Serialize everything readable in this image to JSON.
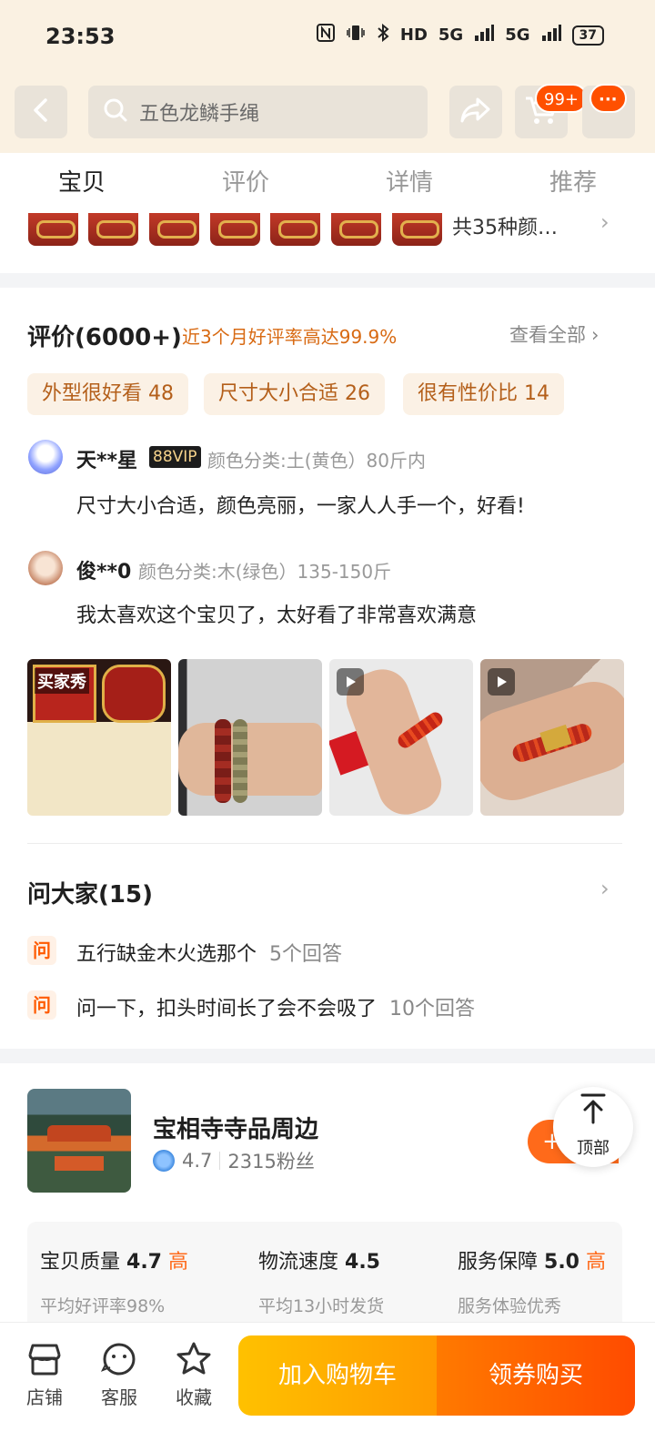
{
  "status_bar": {
    "time": "23:53",
    "network": "HD",
    "signal1": "5G",
    "signal2": "5G",
    "battery": "37"
  },
  "header": {
    "search_text": "五色龙鳞手绳",
    "cart_badge": "99+",
    "more_badge": "···",
    "more_icon": "ellipsis-icon"
  },
  "tabs": [
    {
      "label": "宝贝",
      "active": true
    },
    {
      "label": "评价",
      "active": false
    },
    {
      "label": "详情",
      "active": false
    },
    {
      "label": "推荐",
      "active": false
    }
  ],
  "variants": {
    "thumb_count": 7,
    "more_text": "共35种颜…",
    "chevron": "›"
  },
  "reviews": {
    "title": "评价(6000+)",
    "subtitle": "近3个月好评率高达99.9%",
    "see_all": "查看全部",
    "chevron": "›",
    "tags": [
      "外型很好看 48",
      "尺寸大小合适 26",
      "很有性价比 14"
    ],
    "items": [
      {
        "name": "天**星",
        "vip": "88VIP",
        "meta": "颜色分类:土(黄色）80斤内",
        "text": "尺寸大小合适，颜色亮丽，一家人人手一个，好看!"
      },
      {
        "name": "俊**0",
        "vip": "",
        "meta": "颜色分类:木(绿色）135-150斤",
        "text": "我太喜欢这个宝贝了，太好看了非常喜欢满意"
      }
    ],
    "photo_label": "买家秀"
  },
  "ask": {
    "title": "问大家(15)",
    "chevron": "›",
    "icon_text": "问",
    "questions": [
      {
        "q": "五行缺金木火选那个",
        "count": "5个回答"
      },
      {
        "q": "问一下，扣头时间长了会不会吸了",
        "count": "10个回答"
      }
    ]
  },
  "shop": {
    "name": "宝相寺寺品周边",
    "rating": "4.7",
    "fans": "2315粉丝",
    "follow_label": "+",
    "scores": [
      {
        "label": "宝贝质量",
        "value": "4.7",
        "level": "高",
        "sub": "平均好评率98%"
      },
      {
        "label": "物流速度",
        "value": "4.5",
        "level": "",
        "sub": "平均13小时发货"
      },
      {
        "label": "服务保障",
        "value": "5.0",
        "level": "高",
        "sub": "服务体验优秀"
      }
    ]
  },
  "back_to_top": {
    "arrow": "⭱",
    "label": "顶部"
  },
  "bottom_bar": {
    "items": [
      {
        "label": "店铺",
        "icon": "store-icon"
      },
      {
        "label": "客服",
        "icon": "customer-service-icon"
      },
      {
        "label": "收藏",
        "icon": "star-icon"
      }
    ],
    "add_cart": "加入购物车",
    "buy": "领券购买"
  },
  "colors": {
    "accent": "#ff5000",
    "header_bg": "#faf1e2",
    "cart_btn": "#ffb000",
    "buy_btn": "#ff5a00"
  }
}
